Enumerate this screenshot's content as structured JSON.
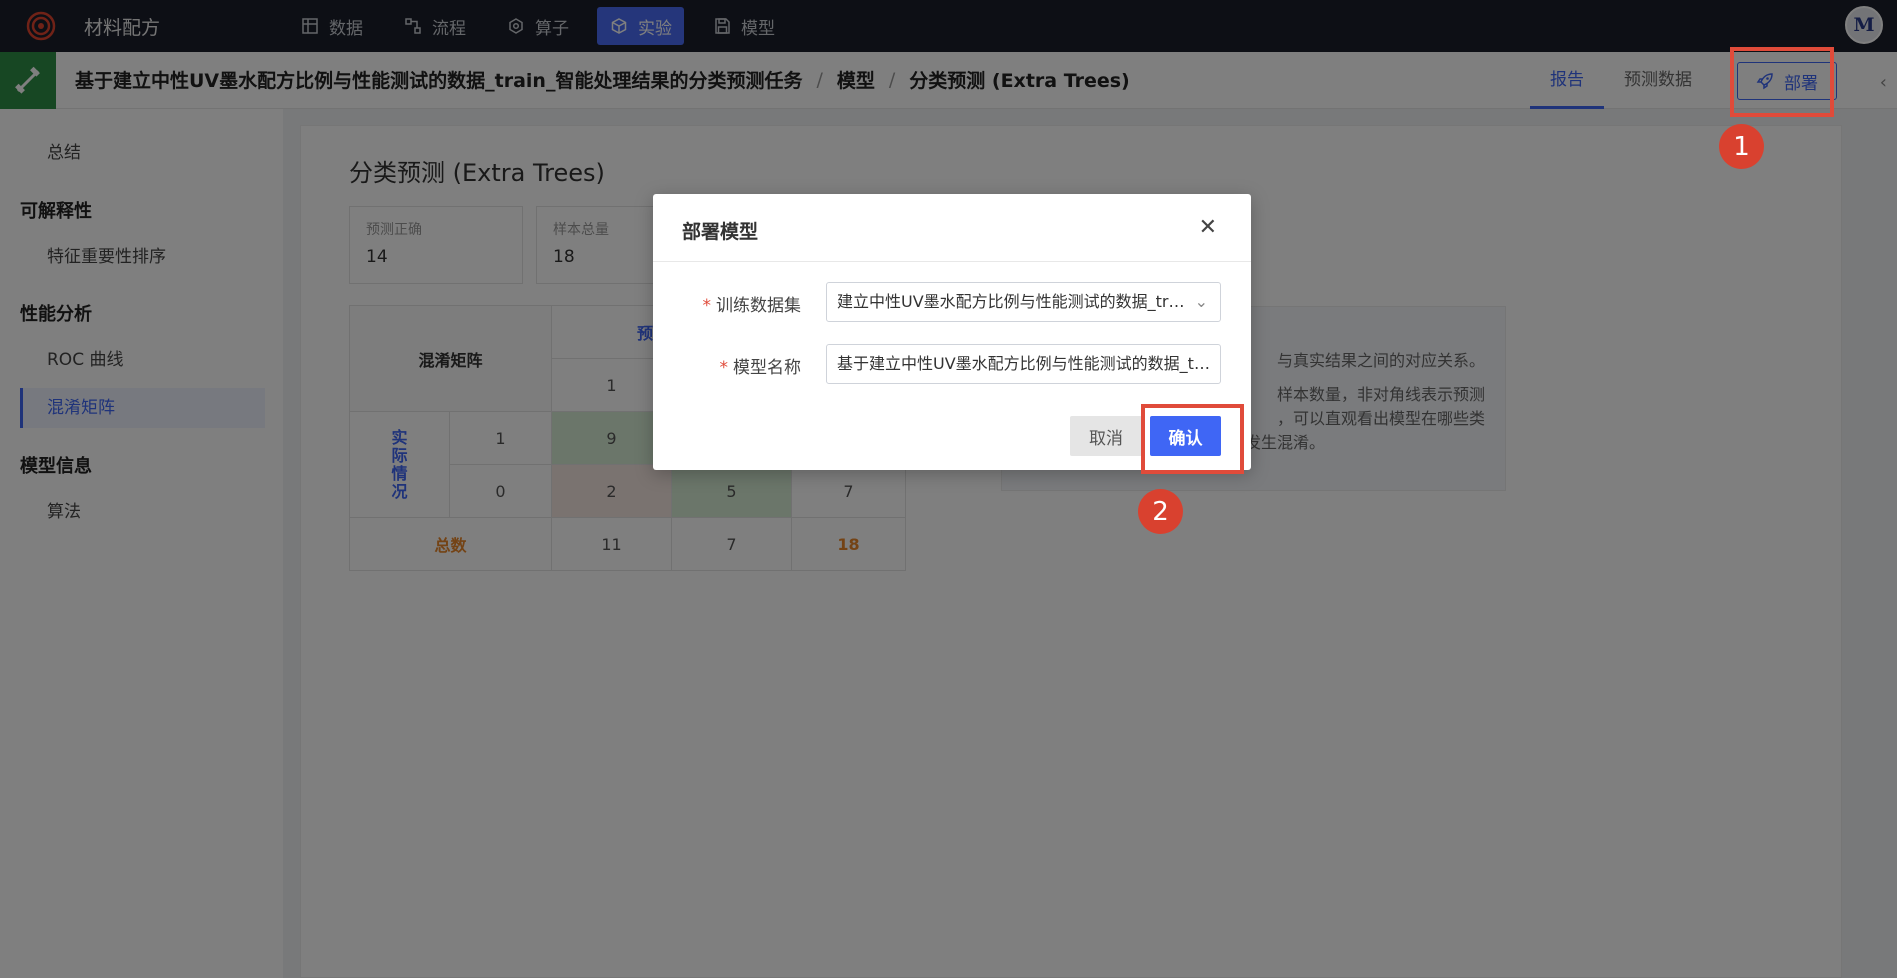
{
  "app": {
    "title": "材料配方"
  },
  "nav": {
    "items": [
      {
        "label": "数据",
        "icon": "table-icon"
      },
      {
        "label": "流程",
        "icon": "flow-icon"
      },
      {
        "label": "算子",
        "icon": "operator-icon"
      },
      {
        "label": "实验",
        "icon": "experiment-icon",
        "active": true
      },
      {
        "label": "模型",
        "icon": "model-icon"
      }
    ],
    "avatar": "M"
  },
  "breadcrumb": {
    "task": "基于建立中性UV墨水配方比例与性能测试的数据_train_智能处理结果的分类预测任务",
    "sep": "/",
    "section": "模型",
    "page": "分类预测 (Extra Trees)"
  },
  "tabs": [
    "报告",
    "预测数据"
  ],
  "deploy_button": "部署",
  "sidebar": {
    "summary": "总结",
    "groups": [
      {
        "title": "可解释性",
        "items": [
          "特征重要性排序"
        ]
      },
      {
        "title": "性能分析",
        "items": [
          "ROC 曲线",
          "混淆矩阵"
        ]
      },
      {
        "title": "模型信息",
        "items": [
          "算法"
        ]
      }
    ],
    "active_item": "混淆矩阵"
  },
  "main": {
    "title": "分类预测 (Extra Trees)",
    "stats": [
      {
        "label": "预测正确",
        "value": "14"
      },
      {
        "label": "样本总量",
        "value": "18"
      }
    ],
    "confusion_matrix": {
      "corner": "混淆矩阵",
      "predicted_header": "预",
      "actual_header": "实际情况",
      "pred_cols": [
        "1"
      ],
      "rows": [
        {
          "label": "1",
          "cells": [
            "9",
            "",
            ""
          ]
        },
        {
          "label": "0",
          "cells": [
            "2",
            "5",
            "7"
          ]
        }
      ],
      "total_label": "总数",
      "totals": [
        "11",
        "7",
        "18"
      ]
    },
    "note": {
      "line1": "与真实结果之间的对应关系。",
      "line2": "样本数量，非对角线表示预测",
      "line3": "，可以直观看出模型在哪些类",
      "line4": "间容易发生混淆。"
    }
  },
  "modal": {
    "title": "部署模型",
    "fields": [
      {
        "label": "训练数据集",
        "value": "建立中性UV墨水配方比例与性能测试的数据_train_智能处理结果",
        "required": true,
        "type": "select"
      },
      {
        "label": "模型名称",
        "value": "基于建立中性UV墨水配方比例与性能测试的数据_train_智能处理结果的分类预测任务",
        "required": true,
        "type": "text"
      }
    ],
    "cancel": "取消",
    "confirm": "确认"
  },
  "annotations": {
    "step1": "1",
    "step2": "2",
    "color": "#e04b3a"
  }
}
